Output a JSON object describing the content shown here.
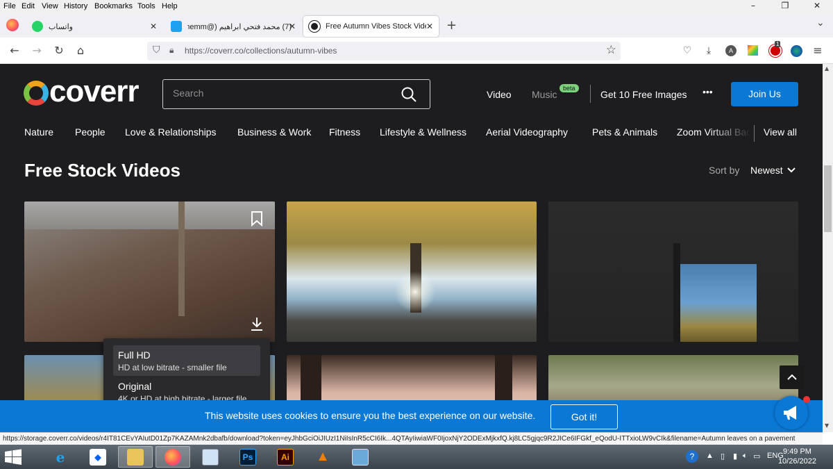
{
  "menubar": {
    "items": [
      "File",
      "Edit",
      "View",
      "History",
      "Bookmarks",
      "Tools",
      "Help"
    ],
    "window_controls": {
      "minimize": "–",
      "restore": "❐",
      "close": "✕"
    }
  },
  "tabs": [
    {
      "title": "واتساب",
      "active": false,
      "icon_color": "#25d366"
    },
    {
      "title": "(7) محمد فتحي ابراهيم (@memm",
      "active": false,
      "icon_color": "#1da1f2"
    },
    {
      "title": "Free Autumn Vibes Stock Video",
      "active": true,
      "icon_color": "#1d1d1f"
    }
  ],
  "new_tab_label": "+",
  "tab_list_label": "⌄",
  "navbar": {
    "url": "https://coverr.co/collections/autumn-vibes",
    "ext_badge": "1"
  },
  "site": {
    "logo_text": "coverr",
    "search_placeholder": "Search",
    "topnav": {
      "video": "Video",
      "music": "Music",
      "beta": "beta",
      "free_images": "Get 10 Free Images",
      "more": "•••",
      "join": "Join Us"
    },
    "categories": [
      "Nature",
      "People",
      "Love & Relationships",
      "Business & Work",
      "Fitness",
      "Lifestyle & Wellness",
      "Aerial Videography",
      "Pets & Animals",
      "Zoom Virtual Backgrounds"
    ],
    "view_all": "View all",
    "page_title": "Free Stock Videos",
    "sort_label": "Sort by",
    "sort_value": "Newest",
    "download_menu": [
      {
        "title": "Full HD",
        "desc": "HD at low bitrate - smaller file",
        "highlighted": true
      },
      {
        "title": "Original",
        "desc": "4K or HD at high bitrate - larger file",
        "highlighted": false
      }
    ],
    "cookie_text": "This website uses cookies to ensure you the best experience on our website.",
    "cookie_button": "Got it!"
  },
  "status_url": "https://storage.coverr.co/videos/r4IT81CEvYAIutD01Zp7KAZAMnk2dbafb/download?token=eyJhbGciOiJIUzI1NiIsInR5cCI6Ik...4QTAyIiwiaWF0IjoxNjY2ODExMjkxfQ.kj8LC5gjqc9R2JICe6IFGkf_eQodU-ITTxioLW9vCIk&filename=Autumn leaves on a pavement",
  "taskbar": {
    "apps": [
      "ie",
      "dropbox",
      "file-explorer",
      "firefox",
      "control-panel",
      "photoshop",
      "illustrator",
      "vlc",
      "remote-desktop"
    ],
    "ps_label": "Ps",
    "ai_label": "Ai",
    "language": "ENG",
    "time": "9:49 PM",
    "date": "10/26/2022"
  },
  "colors": {
    "site_bg": "#1d1d1f",
    "accent_blue": "#0a78d5",
    "beta_green": "#7cd17a"
  }
}
